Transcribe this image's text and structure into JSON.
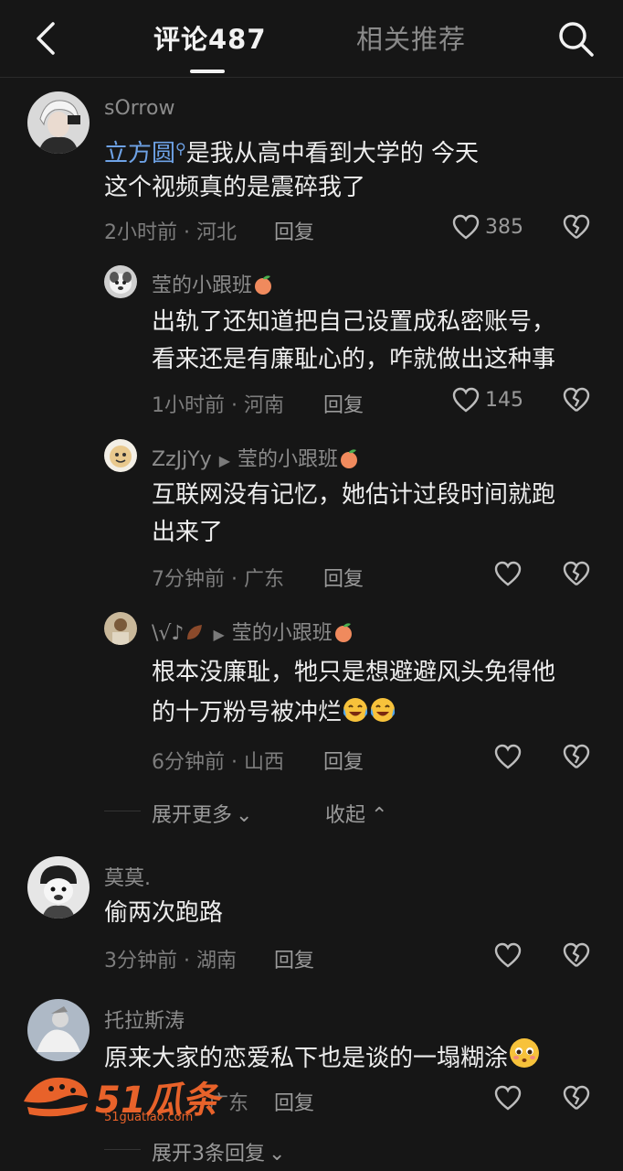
{
  "header": {
    "tab_comments": "评论487",
    "tab_related": "相关推荐"
  },
  "comments": [
    {
      "username": "sOrrow",
      "mention": "立方圆",
      "text_line1_after_mention": "是我从高中看到大学的 今天",
      "text_line2": "这个视频真的是震碎我了",
      "meta": "2小时前 · 河北",
      "reply": "回复",
      "likes": "385"
    },
    {
      "username": "莹的小跟班",
      "text_line1": "出轨了还知道把自己设置成私密账号，",
      "text_line2": "看来还是有廉耻心的，咋就做出这种事",
      "meta": "1小时前 · 河南",
      "reply": "回复",
      "likes": "145"
    },
    {
      "username": "ZzJjYy",
      "reply_to": "莹的小跟班",
      "text_line1": "互联网没有记忆，她估计过段时间就跑",
      "text_line2": "出来了",
      "meta": "7分钟前 · 广东",
      "reply": "回复"
    },
    {
      "username": "\\√♪",
      "reply_to": "莹的小跟班",
      "text_line1": "根本没廉耻，牠只是想避避风头免得他",
      "text_line2": "的十万粉号被冲烂",
      "meta": "6分钟前 · 山西",
      "reply": "回复"
    },
    {
      "username": "莫莫.",
      "text_line1": "偷两次跑路",
      "meta": "3分钟前 · 湖南",
      "reply": "回复"
    },
    {
      "username": "托拉斯涛",
      "text_line1": "原来大家的恋爱私下也是谈的一塌糊涂",
      "meta": "广东",
      "reply": "回复"
    }
  ],
  "thread_controls": {
    "expand_more": "展开更多",
    "collapse": "收起",
    "expand_replies": "展开3条回复"
  },
  "watermark": {
    "brand": "51瓜条",
    "url": "51guatiao.com"
  },
  "colors": {
    "background": "#161616",
    "mention": "#6ea2e6",
    "watermark": "#e8622a"
  }
}
